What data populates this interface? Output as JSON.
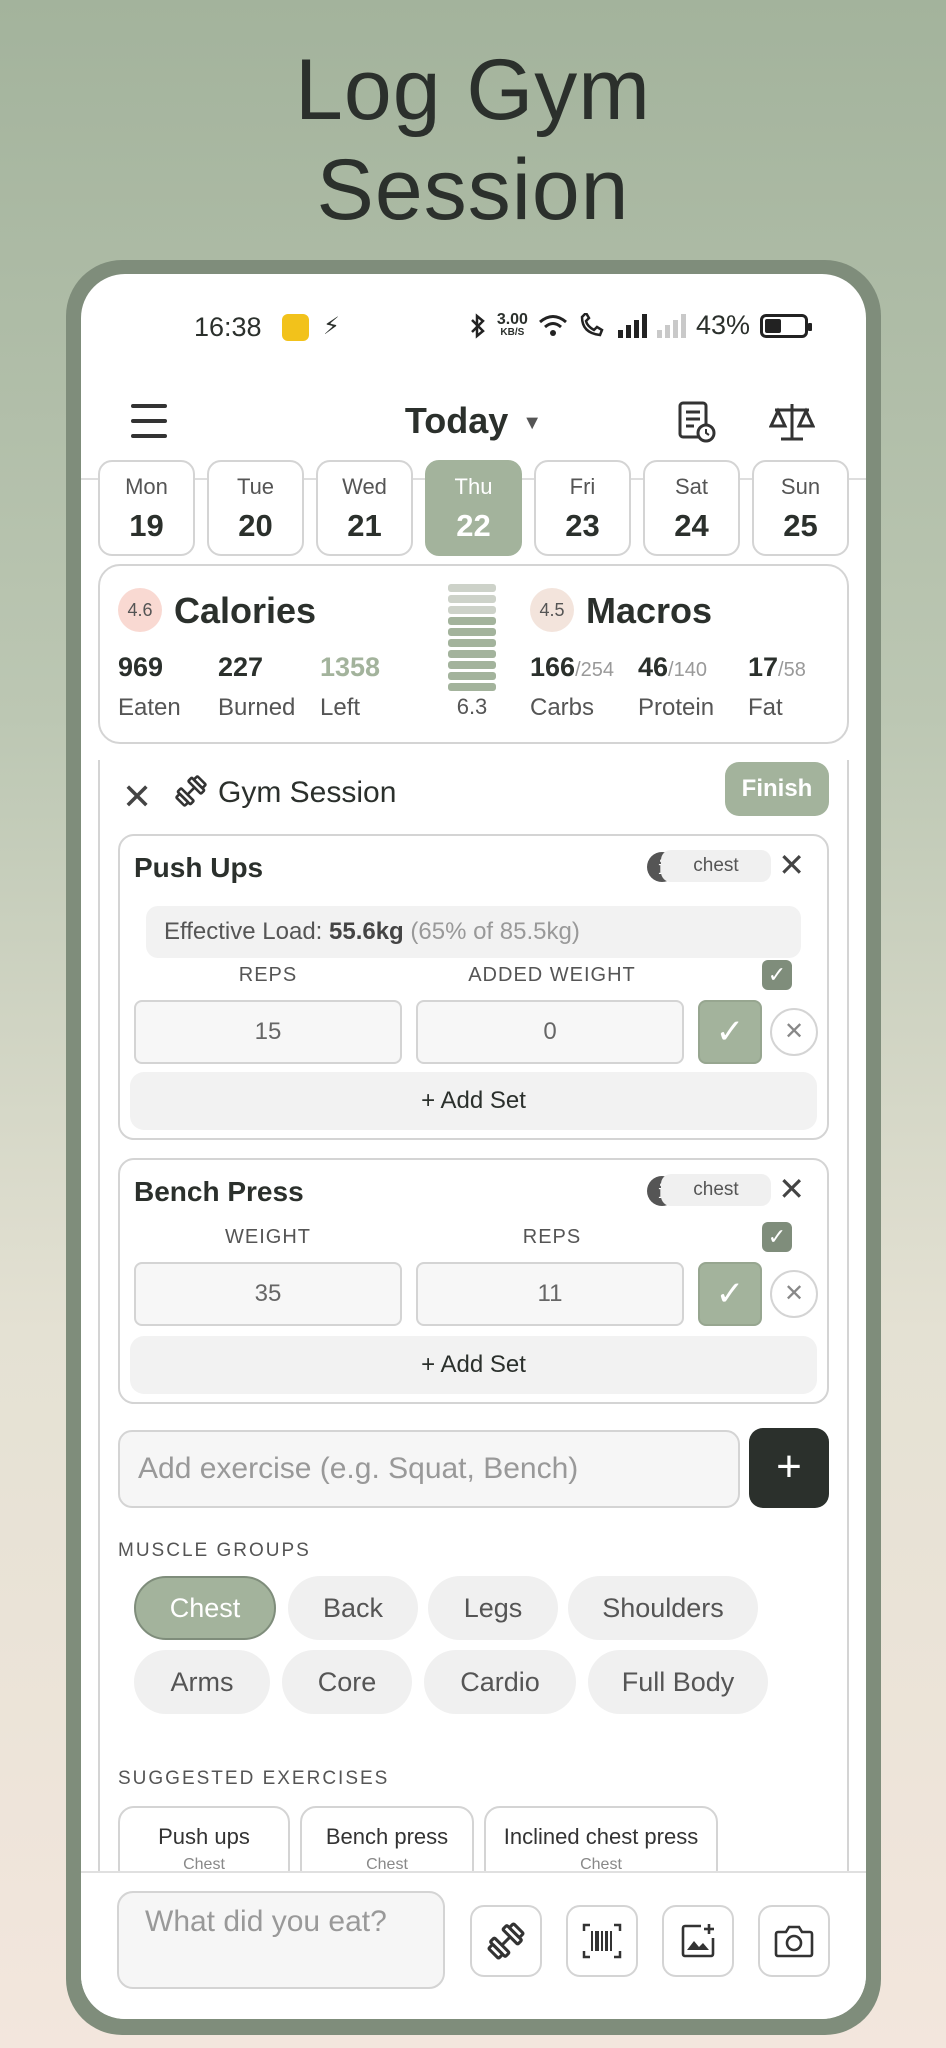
{
  "hero": {
    "line1": "Log Gym",
    "line2": "Session"
  },
  "status": {
    "time": "16:38",
    "speed_top": "3.00",
    "speed_unit": "KB/S",
    "battery": "43%"
  },
  "header": {
    "title": "Today",
    "caret": "▼"
  },
  "days": [
    {
      "name": "Mon",
      "date": "19"
    },
    {
      "name": "Tue",
      "date": "20"
    },
    {
      "name": "Wed",
      "date": "21"
    },
    {
      "name": "Thu",
      "date": "22"
    },
    {
      "name": "Fri",
      "date": "23"
    },
    {
      "name": "Sat",
      "date": "24"
    },
    {
      "name": "Sun",
      "date": "25"
    }
  ],
  "summary": {
    "calories": {
      "score": "4.6",
      "title": "Calories",
      "eaten": "969",
      "eaten_label": "Eaten",
      "burned": "227",
      "burned_label": "Burned",
      "left": "1358",
      "left_label": "Left"
    },
    "meter_value": "6.3",
    "macros": {
      "score": "4.5",
      "title": "Macros",
      "carbs": "166",
      "carbs_target": "/254",
      "carbs_label": "Carbs",
      "protein": "46",
      "protein_target": "/140",
      "protein_label": "Protein",
      "fat": "17",
      "fat_target": "/58",
      "fat_label": "Fat"
    }
  },
  "session": {
    "close": "✕",
    "title": "Gym Session",
    "finish": "Finish",
    "exercises": [
      {
        "name": "Push Ups",
        "info": "i",
        "tag": "chest",
        "remove": "✕",
        "effective_label": "Effective Load: ",
        "effective_value": "55.6kg",
        "effective_pct": "(65% of 85.5kg)",
        "col1": "REPS",
        "col2": "ADDED WEIGHT",
        "set_value1": "15",
        "set_value2": "0",
        "add_set": "+ Add Set"
      },
      {
        "name": "Bench Press",
        "info": "i",
        "tag": "chest",
        "remove": "✕",
        "col1": "WEIGHT",
        "col2": "REPS",
        "set_value1": "35",
        "set_value2": "11",
        "add_set": "+ Add Set"
      }
    ],
    "add_exercise_placeholder": "Add exercise (e.g. Squat, Bench)",
    "add_exercise_button": "+",
    "muscle_groups_label": "MUSCLE GROUPS",
    "muscle_groups": [
      "Chest",
      "Back",
      "Legs",
      "Shoulders",
      "Arms",
      "Core",
      "Cardio",
      "Full Body"
    ],
    "suggested_label": "SUGGESTED EXERCISES",
    "suggested": [
      {
        "name": "Push ups",
        "muscle": "Chest"
      },
      {
        "name": "Bench press",
        "muscle": "Chest"
      },
      {
        "name": "Inclined chest press",
        "muscle": "Chest"
      }
    ]
  },
  "bottom": {
    "placeholder": "What did you eat?"
  },
  "colors": {
    "accent": "#a3b39c",
    "dark": "#2b302c",
    "frame": "#7f8d7b"
  },
  "icons": [
    "menu-icon",
    "report-icon",
    "scale-icon",
    "dumbbell-icon",
    "barcode-icon",
    "image-add-icon",
    "camera-icon",
    "info-icon",
    "close-icon",
    "check-icon"
  ]
}
